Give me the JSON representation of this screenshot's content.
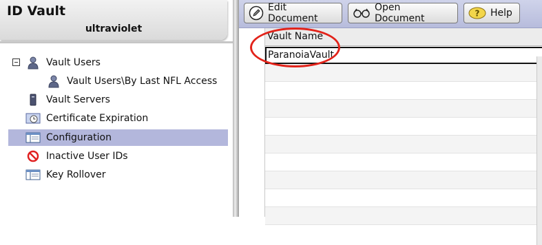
{
  "header": {
    "title": "ID Vault",
    "server": "ultraviolet"
  },
  "tree": {
    "items": [
      {
        "label": "Vault Users",
        "icon": "user-icon"
      },
      {
        "label": "Vault Users\\By Last NFL Access",
        "icon": "user-icon"
      },
      {
        "label": "Vault Servers",
        "icon": "server-icon"
      },
      {
        "label": "Certificate Expiration",
        "icon": "certificate-clock-icon"
      },
      {
        "label": "Configuration",
        "icon": "configuration-icon",
        "selected": true
      },
      {
        "label": "Inactive User IDs",
        "icon": "prohibited-icon"
      },
      {
        "label": "Key Rollover",
        "icon": "key-rollover-icon"
      }
    ]
  },
  "toolbar": {
    "edit_label": "Edit Document",
    "open_label": "Open Document",
    "help_label": "Help"
  },
  "grid": {
    "column_header": "Vault Name",
    "rows": [
      "ParanoiaVault"
    ]
  },
  "colors": {
    "selection": "#b3b7dc",
    "toolbar": "#bfc4e2",
    "annotation": "#e2231a"
  }
}
